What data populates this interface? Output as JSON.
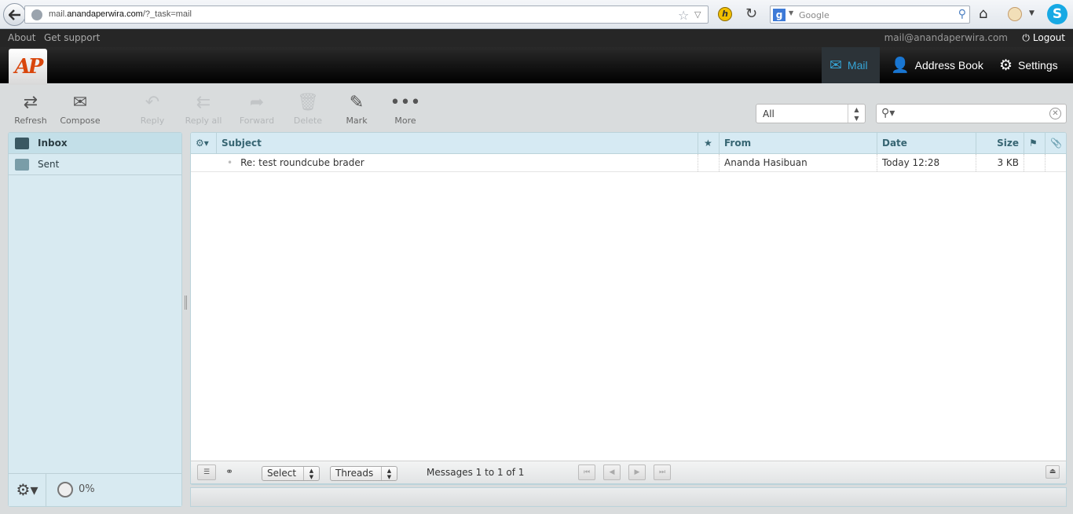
{
  "browser": {
    "url_prefix": "mail.",
    "url_domain": "anandaperwira.com",
    "url_suffix": "/?_task=mail",
    "search_placeholder": "Google"
  },
  "topline": {
    "about": "About",
    "support": "Get support",
    "user": "mail@anandaperwira.com",
    "logout": "Logout"
  },
  "header": {
    "logo": "AP",
    "nav": {
      "mail": "Mail",
      "address_book": "Address Book",
      "settings": "Settings"
    }
  },
  "toolbar": {
    "refresh": "Refresh",
    "compose": "Compose",
    "reply": "Reply",
    "reply_all": "Reply all",
    "forward": "Forward",
    "delete": "Delete",
    "mark": "Mark",
    "more": "More"
  },
  "filter": {
    "selected": "All"
  },
  "folders": [
    {
      "name": "Inbox",
      "selected": true
    },
    {
      "name": "Sent",
      "selected": false
    }
  ],
  "quota": "0%",
  "list": {
    "columns": {
      "subject": "Subject",
      "from": "From",
      "date": "Date",
      "size": "Size"
    },
    "rows": [
      {
        "subject": "Re: test roundcube brader",
        "from": "Ananda Hasibuan",
        "date": "Today 12:28",
        "size": "3 KB"
      }
    ]
  },
  "footer": {
    "select": "Select",
    "threads": "Threads",
    "count": "Messages 1 to 1 of 1"
  },
  "colors": {
    "accent": "#36a5d6",
    "logo": "#d9460c",
    "panel": "#d8eaf1"
  }
}
